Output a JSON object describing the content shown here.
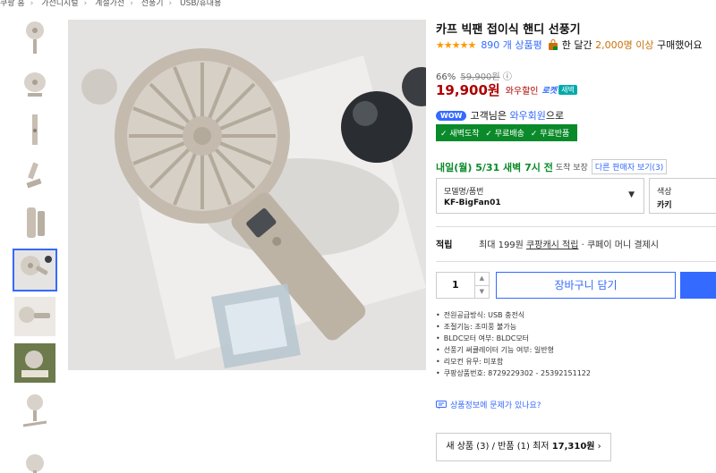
{
  "breadcrumb": [
    "쿠팡 홈",
    "가전디지털",
    "계절가전",
    "선풍기",
    "USB/휴대용"
  ],
  "thumbnails": [
    {
      "name": "thumb-fan-standing"
    },
    {
      "name": "thumb-fan-desk"
    },
    {
      "name": "thumb-fan-side"
    },
    {
      "name": "thumb-fan-folded"
    },
    {
      "name": "thumb-fan-handle"
    },
    {
      "name": "thumb-fan-main",
      "active": true
    },
    {
      "name": "thumb-fan-person"
    },
    {
      "name": "thumb-fan-desk-scene"
    },
    {
      "name": "thumb-fan-tilt"
    },
    {
      "name": "thumb-fan-extra"
    }
  ],
  "product": {
    "title": "카프 빅팬 접이식 핸디 선풍기",
    "stars": "★★★★★",
    "review_count": "890 개 상품평",
    "buy_prefix": "한 달간 ",
    "buy_highlight": "2,000명 이상",
    "buy_suffix": " 구매했어요",
    "discount_rate": "66%",
    "original_price": "59,900원",
    "info_icon": "ⓘ",
    "price": "19,900원",
    "wow_discount": "와우할인",
    "rocket_label": "로켓",
    "dawn_label": "새벽",
    "wow_badge": "WOW",
    "wow_prefix": "고객님은 ",
    "wow_link": "와우회원",
    "wow_suffix": "으로",
    "benefits": [
      "✓ 새벽도착",
      "✓ 무료배송",
      "✓ 무료반품"
    ],
    "delivery_date": "내일(월) 5/31 새벽 7시 전",
    "delivery_guarantee": "도착 보장",
    "other_sellers": "다른 판매자 보기(3)",
    "option1_label": "모델명/품번",
    "option1_value": "KF-BigFan01",
    "option2_label": "색상",
    "option2_value": "카키",
    "points_label": "적립",
    "points_prefix": "최대 199원 ",
    "points_link": "쿠팡캐시 적립",
    "points_suffix": " · 쿠페이 머니 결제시",
    "quantity": "1",
    "qty_up": "▲",
    "qty_down": "▼",
    "cart_label": "장바구니 담기",
    "specs": [
      "전원공급방식: USB 충전식",
      "조절기능: 초미풍 불가능",
      "BLDC모터 여부: BLDC모터",
      "선풍기 써큘레이터 기능 여부: 일반형",
      "리모컨 유무: 미포함",
      "쿠팡상품번호: 8729229302 - 25392151122"
    ],
    "report_text": "상품정보에 문제가 있나요?",
    "sellers_prefix": "새 상품 (3) / 반품 (1) 최저 ",
    "sellers_price": "17,310원",
    "sellers_arrow": " ›"
  },
  "colors": {
    "accent": "#346aff",
    "price": "#ae0000",
    "benefit": "#0a8a2a",
    "star": "#ff9900",
    "fan": "#b8afa3"
  }
}
